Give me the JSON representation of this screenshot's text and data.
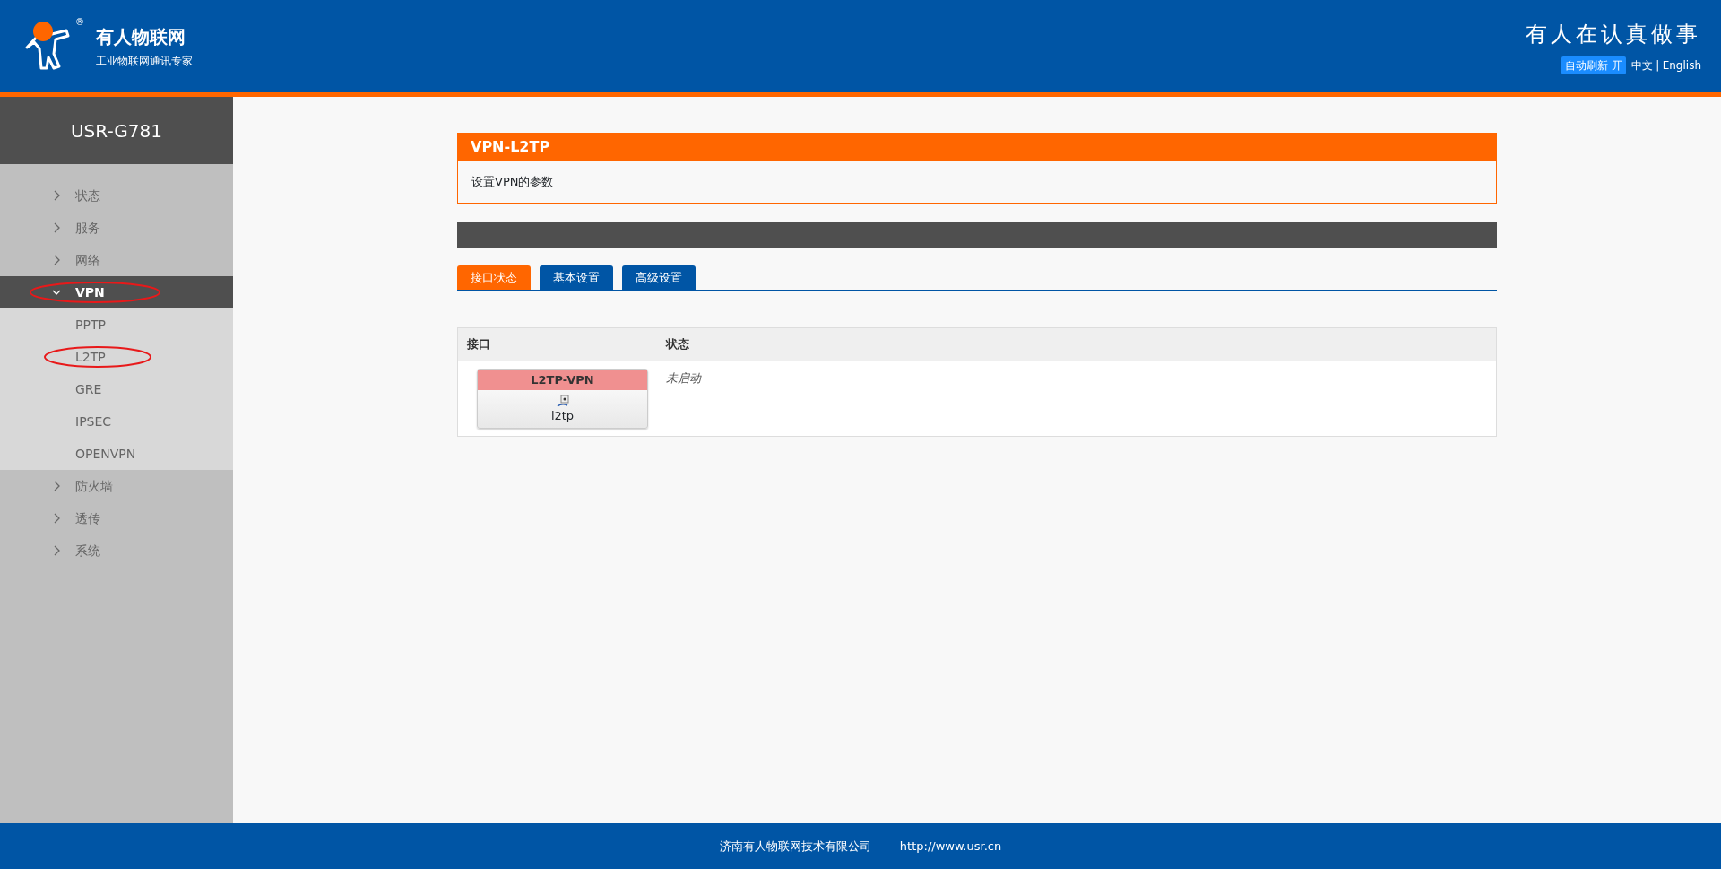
{
  "header": {
    "brand": "有人物联网",
    "registered_mark": "®",
    "tagline": "工业物联网通讯专家",
    "slogan": "有人在认真做事",
    "auto_refresh": "自动刷新 开",
    "languages": [
      "中文",
      "English"
    ],
    "language_separator": "|"
  },
  "sidebar": {
    "title": "USR-G781",
    "items": [
      {
        "label": "状态",
        "expanded": false,
        "circled": false
      },
      {
        "label": "服务",
        "expanded": false,
        "circled": false
      },
      {
        "label": "网络",
        "expanded": false,
        "circled": false
      },
      {
        "label": "VPN",
        "expanded": true,
        "circled": true,
        "children": [
          {
            "label": "PPTP",
            "circled": false
          },
          {
            "label": "L2TP",
            "circled": true
          },
          {
            "label": "GRE",
            "circled": false
          },
          {
            "label": "IPSEC",
            "circled": false
          },
          {
            "label": "OPENVPN",
            "circled": false
          }
        ]
      },
      {
        "label": "防火墙",
        "expanded": false,
        "circled": false
      },
      {
        "label": "透传",
        "expanded": false,
        "circled": false
      },
      {
        "label": "系统",
        "expanded": false,
        "circled": false
      }
    ]
  },
  "panel": {
    "title": "VPN-L2TP",
    "description": "设置VPN的参数"
  },
  "tabs": [
    {
      "label": "接口状态",
      "selected": true
    },
    {
      "label": "基本设置",
      "selected": false
    },
    {
      "label": "高级设置",
      "selected": false
    }
  ],
  "table": {
    "columns": [
      "接口",
      "状态"
    ],
    "rows": [
      {
        "interface": {
          "name": "L2TP-VPN",
          "device": "l2tp",
          "running": false
        },
        "status": "未启动"
      }
    ]
  },
  "footer": {
    "company": "济南有人物联网技术有限公司",
    "url": "http://www.usr.cn"
  }
}
